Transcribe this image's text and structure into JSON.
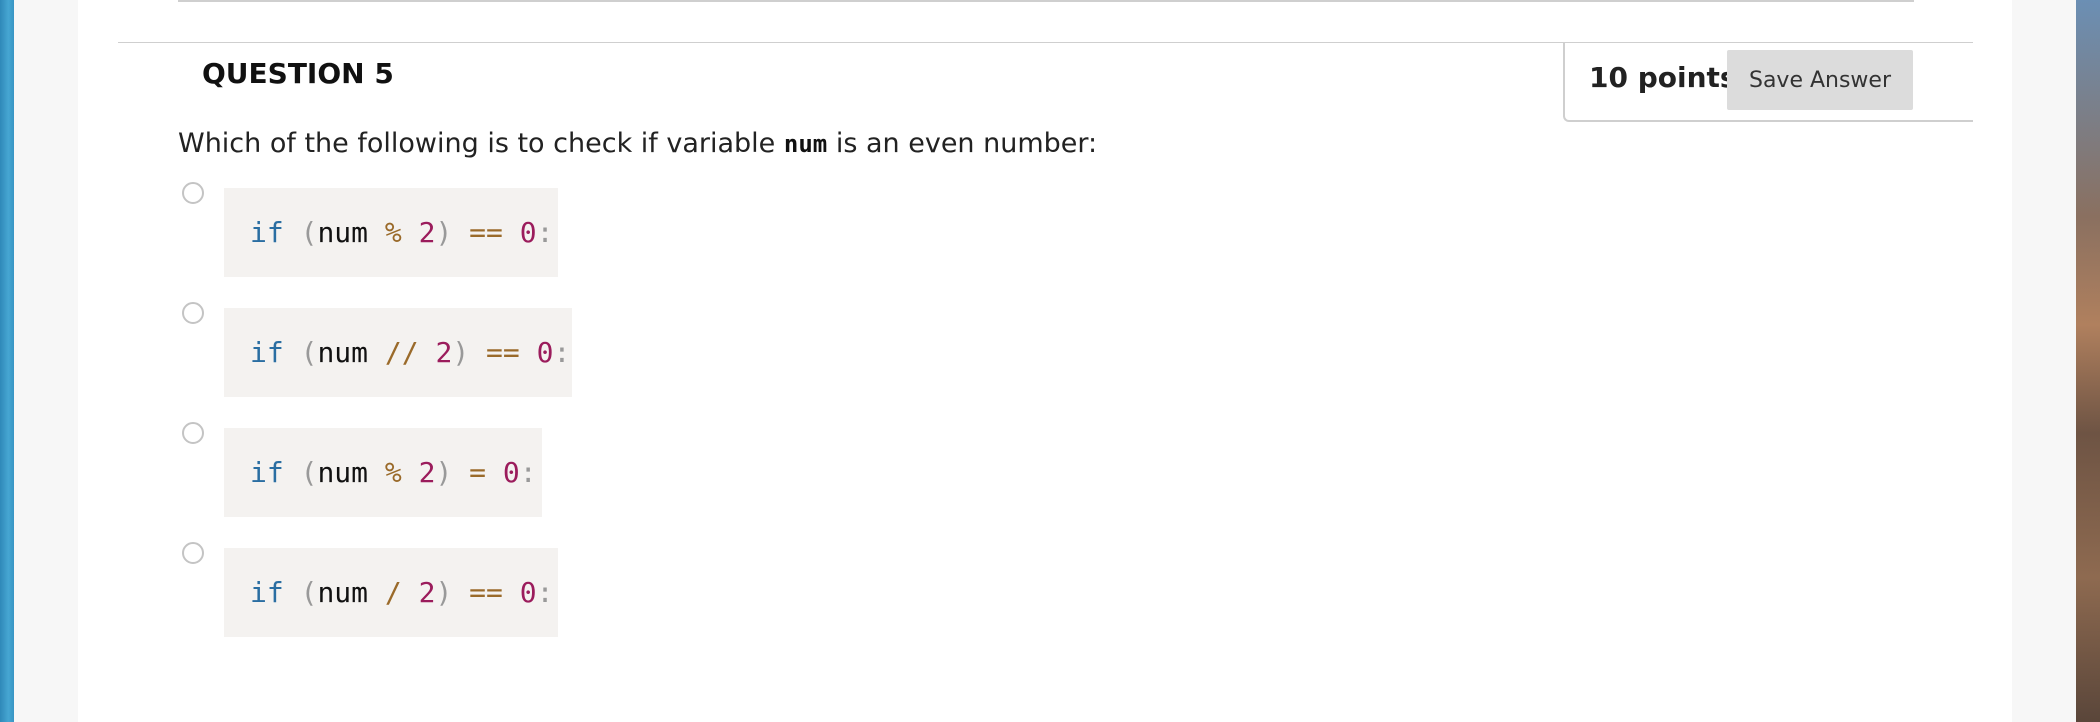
{
  "question": {
    "title": "QUESTION 5",
    "points": "10 points",
    "save_label": "Save Answer",
    "text_before": "Which of the following is to check if variable ",
    "text_code": "num",
    "text_after": " is an even number:"
  },
  "options": [
    {
      "kw": "if",
      "open": " (",
      "var": "num",
      "sp1": " ",
      "op1": "%",
      "sp2": " ",
      "n1": "2",
      "close": ")",
      "sp3": " ",
      "op2": "==",
      "sp4": " ",
      "n2": "0",
      "colon": ":"
    },
    {
      "kw": "if",
      "open": " (",
      "var": "num",
      "sp1": " ",
      "op1": "//",
      "sp2": " ",
      "n1": "2",
      "close": ")",
      "sp3": " ",
      "op2": "==",
      "sp4": " ",
      "n2": "0",
      "colon": ":"
    },
    {
      "kw": "if",
      "open": " (",
      "var": "num",
      "sp1": " ",
      "op1": "%",
      "sp2": " ",
      "n1": "2",
      "close": ")",
      "sp3": " ",
      "op2": "=",
      "sp4": " ",
      "n2": "0",
      "colon": ":"
    },
    {
      "kw": "if",
      "open": " (",
      "var": "num",
      "sp1": " ",
      "op1": "/",
      "sp2": " ",
      "n1": "2",
      "close": ")",
      "sp3": " ",
      "op2": "==",
      "sp4": " ",
      "n2": "0",
      "colon": ":"
    }
  ]
}
